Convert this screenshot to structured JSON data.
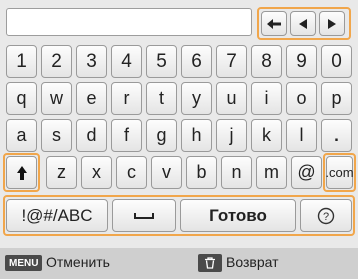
{
  "cursor_keys": {
    "backspace_icon": "left-arrow-line-icon",
    "left_icon": "triangle-left-icon",
    "right_icon": "triangle-right-icon"
  },
  "rows": {
    "numbers": [
      "1",
      "2",
      "3",
      "4",
      "5",
      "6",
      "7",
      "8",
      "9",
      "0"
    ],
    "row1": [
      "q",
      "w",
      "e",
      "r",
      "t",
      "y",
      "u",
      "i",
      "o",
      "p"
    ],
    "row2": [
      "a",
      "s",
      "d",
      "f",
      "g",
      "h",
      "j",
      "k",
      "l",
      "."
    ],
    "row3": [
      "z",
      "x",
      "c",
      "v",
      "b",
      "n",
      "m",
      "@"
    ]
  },
  "keys": {
    "shift_icon": "shift-up-arrow-icon",
    "dotcom": ".com",
    "symbols": "!@#/ABC",
    "space_icon": "space-bar-icon",
    "done": "Готово",
    "help": "?"
  },
  "bottom_bar": {
    "menu_badge": "MENU",
    "cancel": "Отменить",
    "trash_icon": "trash-icon",
    "back": "Возврат"
  },
  "colors": {
    "highlight": "#f1a64b",
    "bar_bg": "#cfcfcf"
  }
}
